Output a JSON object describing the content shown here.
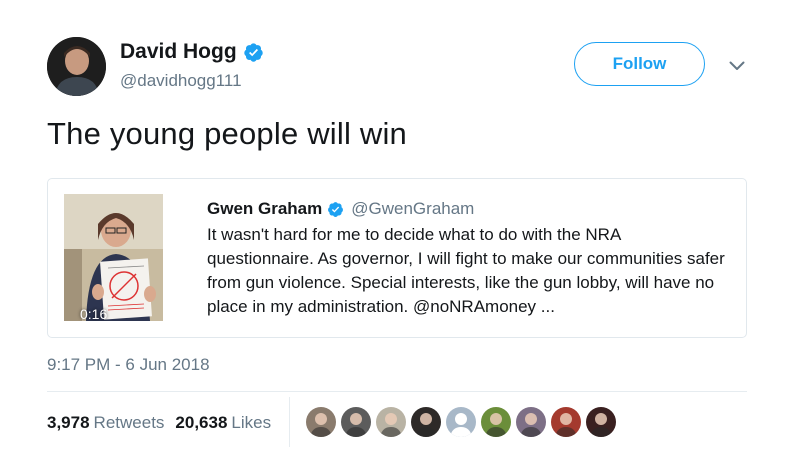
{
  "author": {
    "display_name": "David Hogg",
    "handle": "@davidhogg111",
    "verified": true
  },
  "follow_button": {
    "label": "Follow"
  },
  "tweet": {
    "text": "The young people will win"
  },
  "quoted_tweet": {
    "display_name": "Gwen Graham",
    "handle": "@GwenGraham",
    "verified": true,
    "text": "It wasn't hard for me to decide what to do with the NRA questionnaire. As governor, I will fight to make our communities safer from gun violence. Special interests, like the gun lobby, will have no place in my administration. @noNRAmoney ...",
    "video_duration": "0:16"
  },
  "timestamp": "9:17 PM - 6 Jun 2018",
  "stats": {
    "retweets_count": "3,978",
    "retweets_label": "Retweets",
    "likes_count": "20,638",
    "likes_label": "Likes"
  },
  "likers": [
    {
      "color": "#8a7b6d"
    },
    {
      "color": "#5c5c5c"
    },
    {
      "color": "#b9b3a4"
    },
    {
      "color": "#2e2a28"
    },
    {
      "color": "#a8b8c8"
    },
    {
      "color": "#6b8e3a"
    },
    {
      "color": "#7d6f86"
    },
    {
      "color": "#a43a2e"
    },
    {
      "color": "#3a2020"
    }
  ],
  "colors": {
    "accent": "#1da1f2",
    "text": "#14171a",
    "secondary_text": "#657786",
    "border": "#e1e8ed"
  }
}
